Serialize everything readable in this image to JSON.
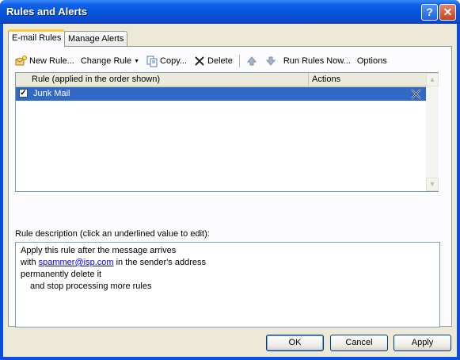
{
  "window": {
    "title": "Rules and Alerts",
    "help_glyph": "?",
    "close_glyph": "✕"
  },
  "tabs": [
    {
      "label": "E-mail Rules"
    },
    {
      "label": "Manage Alerts"
    }
  ],
  "toolbar": {
    "new_rule": "New Rule...",
    "change_rule": "Change Rule",
    "copy": "Copy...",
    "delete": "Delete",
    "run_rules_now": "Run Rules Now...",
    "options": "Options"
  },
  "list": {
    "columns": [
      "Rule (applied in the order shown)",
      "Actions"
    ],
    "rows": [
      {
        "label": "Junk Mail",
        "checked": true
      }
    ]
  },
  "description": {
    "label": "Rule description (click an underlined value to edit):",
    "lines": [
      "Apply this rule after the message arrives",
      "with ",
      "spammer@isp.com",
      " in the sender's address",
      "permanently delete it",
      "and stop processing more rules"
    ]
  },
  "buttons": {
    "ok": "OK",
    "cancel": "Cancel",
    "apply": "Apply"
  },
  "colors": {
    "titlebar": "#0752d8",
    "selection": "#316ac5",
    "face": "#ece9d8",
    "active_tab_accent": "#ffc83c"
  }
}
